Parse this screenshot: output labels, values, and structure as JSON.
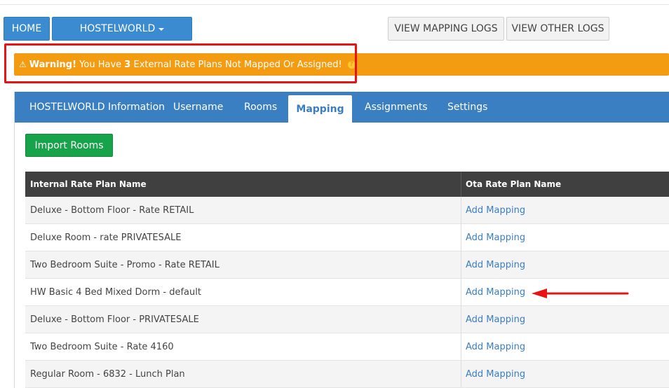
{
  "nav": {
    "home_label": "HOME",
    "channel_label": "HOSTELWORLD",
    "view_mapping_logs_label": "VIEW MAPPING LOGS",
    "view_other_logs_label": "VIEW OTHER LOGS"
  },
  "warning": {
    "icon": "warning-triangle-icon",
    "bold_prefix": "Warning!",
    "text_before": "You Have",
    "count": "3",
    "text_after": "External Rate Plans Not Mapped Or Assigned!",
    "help_icon": "question-circle-icon",
    "help_glyph": "?"
  },
  "tabs": [
    {
      "label": "HOSTELWORLD Information",
      "active": false
    },
    {
      "label": "Username",
      "active": false
    },
    {
      "label": "Rooms",
      "active": false
    },
    {
      "label": "Mapping",
      "active": true
    },
    {
      "label": "Assignments",
      "active": false
    },
    {
      "label": "Settings",
      "active": false
    }
  ],
  "import_button_label": "Import Rooms",
  "table": {
    "headers": [
      "Internal Rate Plan Name",
      "Ota Rate Plan Name"
    ],
    "rows": [
      {
        "internal": "Deluxe - Bottom Floor - Rate RETAIL",
        "action": "Add Mapping"
      },
      {
        "internal": "Deluxe Room - rate PRIVATESALE",
        "action": "Add Mapping"
      },
      {
        "internal": "Two Bedroom Suite - Promo - Rate RETAIL",
        "action": "Add Mapping"
      },
      {
        "internal": "HW Basic 4 Bed Mixed Dorm - default",
        "action": "Add Mapping"
      },
      {
        "internal": "Deluxe - Bottom Floor - PRIVATESALE",
        "action": "Add Mapping"
      },
      {
        "internal": "Two Bedroom Suite - Rate 4160",
        "action": "Add Mapping"
      },
      {
        "internal": "Regular Room - 6832 - Lunch Plan",
        "action": "Add Mapping"
      }
    ]
  },
  "colors": {
    "primary_blue": "#3a8bd0",
    "tab_bar": "#3a7fc1",
    "warning_orange": "#f39c12",
    "success_green": "#16a34a",
    "annotation_red": "#e81313",
    "header_dark": "#404040"
  }
}
